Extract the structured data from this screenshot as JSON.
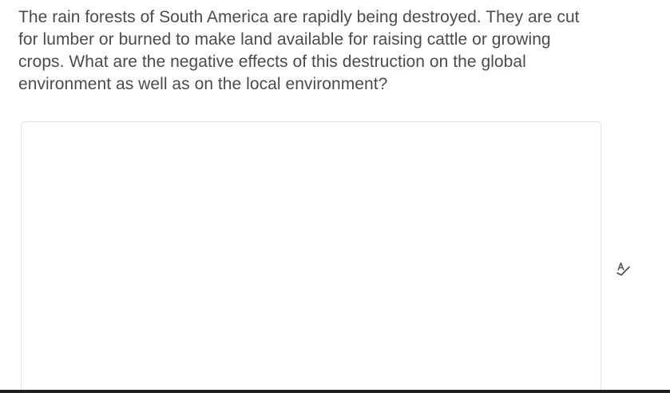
{
  "question": {
    "text": "The rain forests of South America are rapidly being destroyed. They are cut for lumber or burned to make land available for raising cattle or growing crops. What are the negative effects of this destruction on the global environment as well as on the local environment?"
  },
  "answer": {
    "value": "",
    "placeholder": ""
  },
  "toolbar": {
    "spellcheck_icon": "spellcheck-icon"
  },
  "colors": {
    "text": "#494c4e",
    "border": "#e3e5e7",
    "bottom_bar": "#1f1f1f"
  }
}
